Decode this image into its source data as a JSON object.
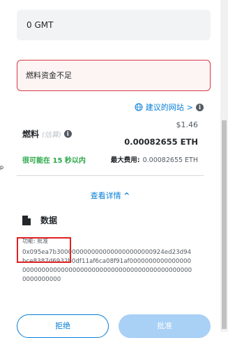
{
  "amount_field": {
    "value": "0 GMT"
  },
  "alert": {
    "text": "燃料资金不足"
  },
  "site_link": {
    "label": "建议的网站",
    "chevron": ">"
  },
  "gas_fee": {
    "label": "燃料",
    "estimate_tag": "(估算)",
    "usd": "$1.46",
    "eth": "0.00082655 ETH",
    "likely_time": "很可能在 15 秒以内",
    "max_fee_label": "最大费用:",
    "max_fee_value": "0.00082655 ETH"
  },
  "details_toggle": {
    "label": "查看详情",
    "chevron": "^"
  },
  "data_section": {
    "title": "数据",
    "function_label": "功能: 批准",
    "hex": "0x095ea7b3000000000000000000000000924ed23d94bce8387d6932b0df11af6ca08f91af0000000000000000000000000000000000000000000000000000000000000000000000"
  },
  "side_mark": "p",
  "buttons": {
    "reject": "拒绝",
    "approve": "批准"
  },
  "colors": {
    "accent": "#037dd6",
    "danger": "#d73a49",
    "success": "#28a745",
    "disabled_primary": "#a9d0f5"
  }
}
